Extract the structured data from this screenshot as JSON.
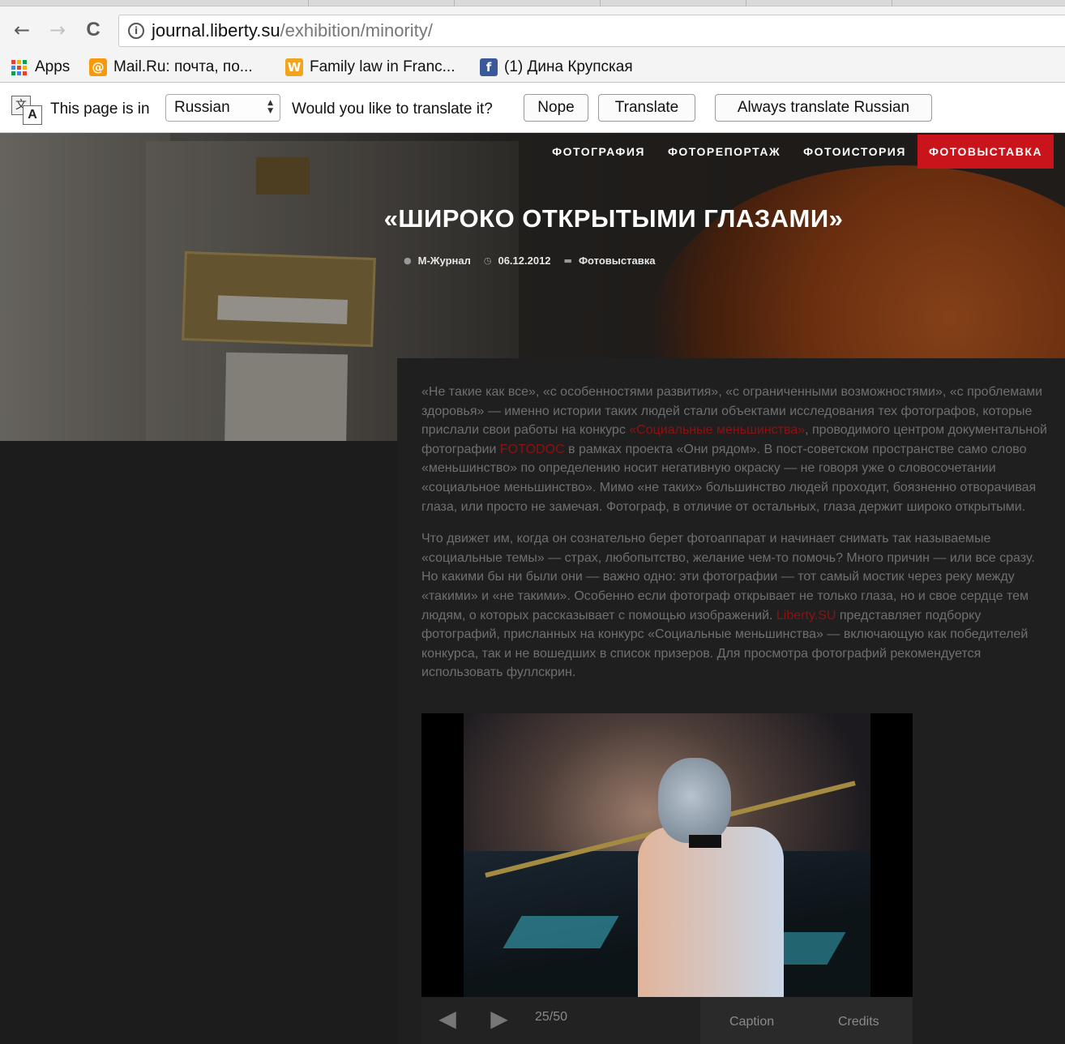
{
  "browser": {
    "nav": {
      "back": "←",
      "forward": "→",
      "reload": "C"
    },
    "url": {
      "host": "journal.liberty.su",
      "path": "/exhibition/minority/"
    },
    "bookmarks": [
      {
        "label": "Apps",
        "icon": "apps-grid-icon"
      },
      {
        "label": "Mail.Ru: почта, по...",
        "icon": "mailru-icon",
        "glyph": "@",
        "color": "#f59a0c"
      },
      {
        "label": "Family law in Franc...",
        "icon": "w-icon",
        "glyph": "W",
        "color": "#f2a41c"
      },
      {
        "label": "(1) Дина Крупская",
        "icon": "facebook-icon",
        "glyph": "f",
        "color": "#3b5998"
      }
    ],
    "translate_bar": {
      "intro": "This page is in",
      "language": "Russian",
      "question": "Would you like to translate it?",
      "nope": "Nope",
      "translate": "Translate",
      "always": "Always translate Russian"
    }
  },
  "site": {
    "menu": [
      "ФОТОГРАФИЯ",
      "ФОТОРЕПОРТАЖ",
      "ФОТОИСТОРИЯ",
      "ФОТОВЫСТАВКА"
    ],
    "active_menu_color": "#c8141a",
    "article": {
      "title": "«ШИРОКО ОТКРЫТЫМИ ГЛАЗАМИ»",
      "author": "М-Журнал",
      "date": "06.12.2012",
      "category": "Фотовыставка",
      "p1": [
        "«Не такие как все», «с особенностями развития», «с ограниченными возможностями», «с проблемами здоровья» — именно истории таких людей стали объектами исследования тех фотографов, которые прислали свои работы на конкурс ",
        "«Социальные меньшинства»",
        ", проводимого центром документальной фотографии ",
        "FOTODOC",
        " в рамках проекта «Они рядом». В пост-советском пространстве само слово «меньшинство» по определению носит негативную окраску — не говоря уже о словосочетании «социальное меньшинство». Мимо «не таких» большинство людей проходит, боязненно отворачивая глаза, или просто не замечая. Фотограф, в отличие от остальных, глаза держит широко открытыми."
      ],
      "p2": [
        "Что движет им, когда он сознательно берет фотоаппарат и начинает снимать так называемые «социальные темы» — страх, любопытство, желание чем-то помочь? Много причин — или все сразу. Но какими бы ни были они — важно одно: эти фотографии — тот самый мостик через реку между «такими» и «не такими». Особенно если фотограф открывает не только глаза, но и свое сердце тем людям, о которых рассказывает с помощью изображений. ",
        "Liberty.SU",
        " представляет подборку фотографий, присланных на конкурс «Социальные меньшинства» — включающую как победителей конкурса, так и не вошедших в список призеров. Для просмотра фотографий рекомендуется использовать фуллскрин."
      ]
    },
    "gallery": {
      "counter": "25/50",
      "caption": "Caption",
      "credits": "Credits",
      "prev": "◀",
      "next": "▶"
    }
  }
}
